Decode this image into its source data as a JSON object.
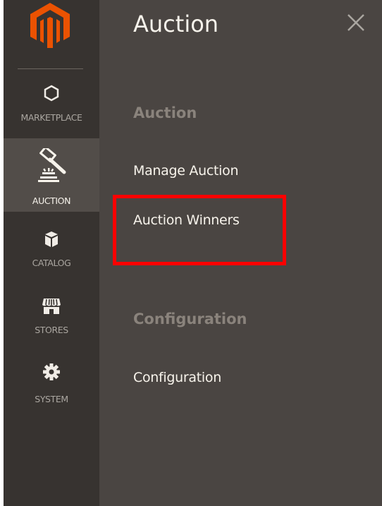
{
  "sidebar": {
    "logo_icon": "magento-logo-icon",
    "items": [
      {
        "label": "MARKETPLACE",
        "icon": "hexagon-icon",
        "active": false
      },
      {
        "label": "AUCTION",
        "icon": "gavel-icon",
        "active": true
      },
      {
        "label": "CATALOG",
        "icon": "box-icon",
        "active": false
      },
      {
        "label": "STORES",
        "icon": "store-icon",
        "active": false
      },
      {
        "label": "SYSTEM",
        "icon": "gear-icon",
        "active": false
      }
    ]
  },
  "panel": {
    "title": "Auction",
    "close_icon": "close-icon",
    "sections": [
      {
        "title": "Auction",
        "links": [
          "Manage Auction",
          "Auction Winners"
        ]
      },
      {
        "title": "Configuration",
        "links": [
          "Configuration"
        ]
      }
    ],
    "highlighted_link": "Auction Winners"
  },
  "colors": {
    "sidebar_bg": "#373330",
    "sidebar_active_bg": "#524d49",
    "panel_bg": "#4a4542",
    "logo_orange": "#eb5202",
    "highlight_red": "#ff0000",
    "text_light": "#f7f3eb",
    "section_muted": "#8a837c"
  }
}
